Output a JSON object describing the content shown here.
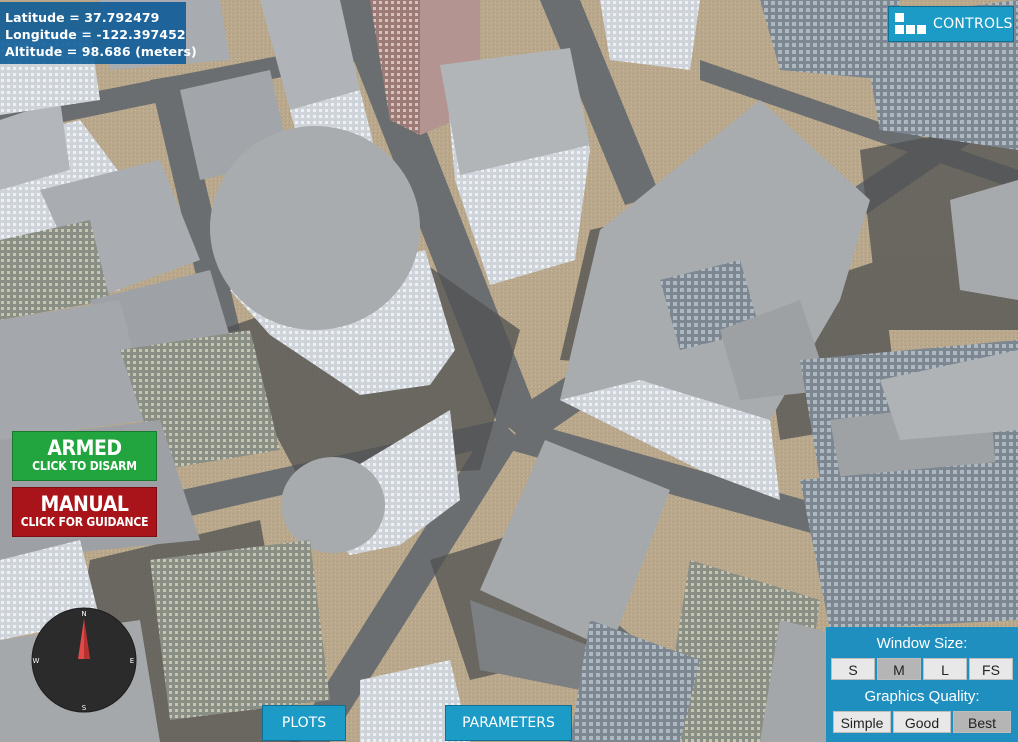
{
  "telemetry": {
    "latitude": "Latitude = 37.792479",
    "longitude": "Longitude = -122.397452",
    "altitude": "Altitude = 98.686 (meters)"
  },
  "controls_button": {
    "label": "CONTROLS"
  },
  "armed_button": {
    "title": "ARMED",
    "subtitle": "CLICK TO DISARM",
    "color": "#22a53e"
  },
  "manual_button": {
    "title": "MANUAL",
    "subtitle": "CLICK FOR GUIDANCE",
    "color": "#a8141a"
  },
  "compass": {
    "north": "N",
    "south": "S",
    "east": "E",
    "west": "W",
    "heading_deg": 0
  },
  "bottom_buttons": {
    "plots": "PLOTS",
    "parameters": "PARAMETERS"
  },
  "settings": {
    "window_size_label": "Window Size:",
    "window_sizes": [
      "S",
      "M",
      "L",
      "FS"
    ],
    "window_size_selected": "M",
    "graphics_quality_label": "Graphics Quality:",
    "graphics_qualities": [
      "Simple",
      "Good",
      "Best"
    ],
    "graphics_quality_selected": "Best"
  },
  "colors": {
    "panel_blue": "#1f8fc0",
    "button_blue": "#1c9bc6",
    "armed_green": "#22a53e",
    "manual_red": "#a8141a"
  }
}
